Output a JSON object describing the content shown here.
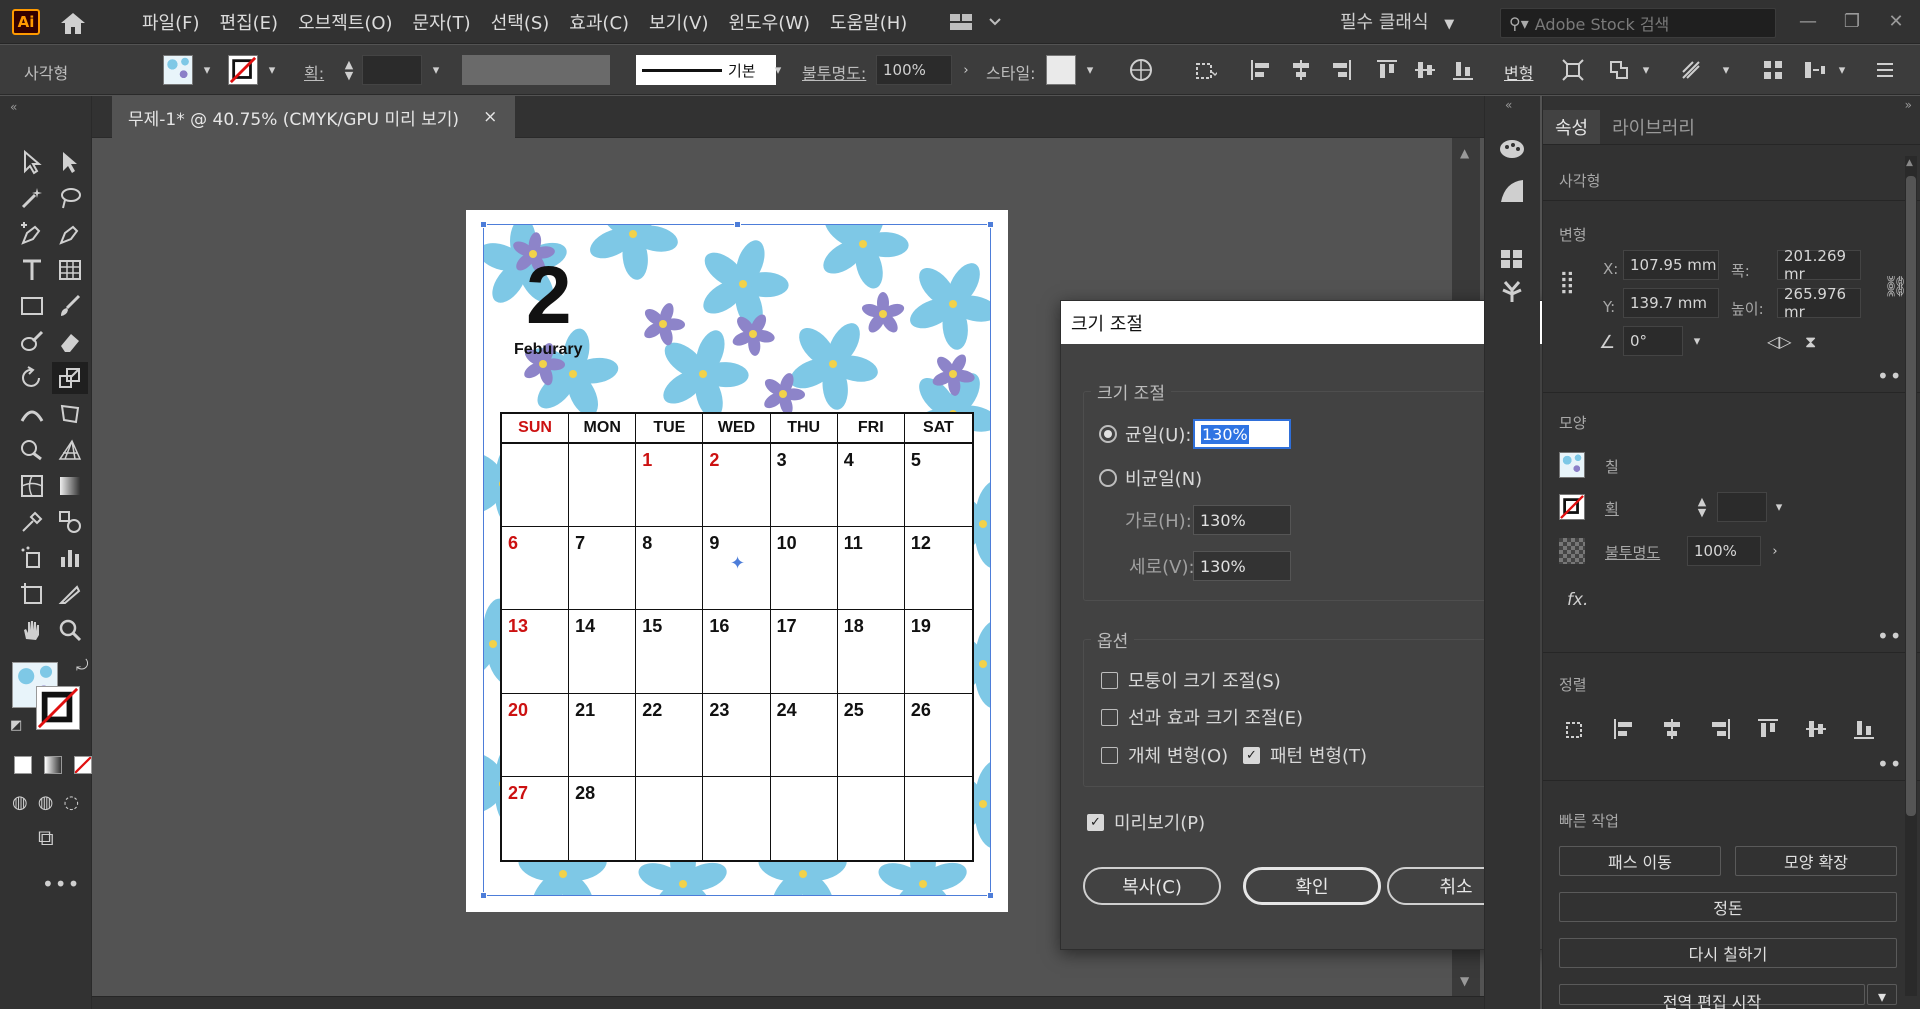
{
  "app": {
    "logo": "Ai",
    "menus": [
      "파일(F)",
      "편집(E)",
      "오브젝트(O)",
      "문자(T)",
      "선택(S)",
      "효과(C)",
      "보기(V)",
      "윈도우(W)",
      "도움말(H)"
    ],
    "workspace": "필수 클래식",
    "search_placeholder": "Adobe Stock 검색"
  },
  "control_bar": {
    "object_type": "사각형",
    "stroke_label": "획:",
    "stroke_style": "기본",
    "opacity_label": "불투명도:",
    "opacity_value": "100%",
    "style_label": "스타일:",
    "transform_link": "변형"
  },
  "document_tab": {
    "title": "무제-1* @ 40.75% (CMYK/GPU 미리 보기)",
    "close": "×"
  },
  "calendar": {
    "month_number": "2",
    "month_name": "Feburary",
    "days": [
      "SUN",
      "MON",
      "TUE",
      "WED",
      "THU",
      "FRI",
      "SAT"
    ],
    "weeks": [
      [
        "",
        "",
        "1",
        "2",
        "3",
        "4",
        "5"
      ],
      [
        "6",
        "7",
        "8",
        "9",
        "10",
        "11",
        "12"
      ],
      [
        "13",
        "14",
        "15",
        "16",
        "17",
        "18",
        "19"
      ],
      [
        "20",
        "21",
        "22",
        "23",
        "24",
        "25",
        "26"
      ],
      [
        "27",
        "28",
        "",
        "",
        "",
        "",
        ""
      ]
    ],
    "red_dates": [
      "1",
      "2",
      "6",
      "13",
      "20",
      "27"
    ]
  },
  "dialog": {
    "title": "크기 조절",
    "scale_group": "크기 조절",
    "uniform_label": "균일(U):",
    "uniform_value": "130%",
    "nonuniform_label": "비균일(N)",
    "horizontal_label": "가로(H):",
    "horizontal_value": "130%",
    "vertical_label": "세로(V):",
    "vertical_value": "130%",
    "options_group": "옵션",
    "scale_corners": "모퉁이 크기 조절(S)",
    "scale_strokes": "선과 효과 크기 조절(E)",
    "transform_objects": "개체 변형(O)",
    "transform_patterns": "패턴 변형(T)",
    "preview": "미리보기(P)",
    "copy_button": "복사(C)",
    "ok_button": "확인",
    "cancel_button": "취소"
  },
  "properties": {
    "tabs": [
      "속성",
      "라이브러리"
    ],
    "object_type": "사각형",
    "transform_title": "변형",
    "x_label": "X:",
    "x_value": "107.95 mm",
    "y_label": "Y:",
    "y_value": "139.7 mm",
    "w_label": "폭:",
    "w_value": "201.269 mr",
    "h_label": "높이:",
    "h_value": "265.976 mr",
    "angle_value": "0°",
    "appearance_title": "모양",
    "fill_label": "칠",
    "stroke_label": "획",
    "opacity_label": "불투명도",
    "opacity_value": "100%",
    "fx_label": "fx.",
    "align_title": "정렬",
    "quick_title": "빠른 작업",
    "offset_path": "패스 이동",
    "expand_appearance": "모양 확장",
    "arrange": "정돈",
    "recolor": "다시 칠하기",
    "global_edit": "전역 편집 시작"
  },
  "colors": {
    "accent_blue": "#2f74e3",
    "sunday_red": "#cc1111",
    "petal_blue": "#7ec8e6",
    "petal_violet": "#8d84c9"
  }
}
